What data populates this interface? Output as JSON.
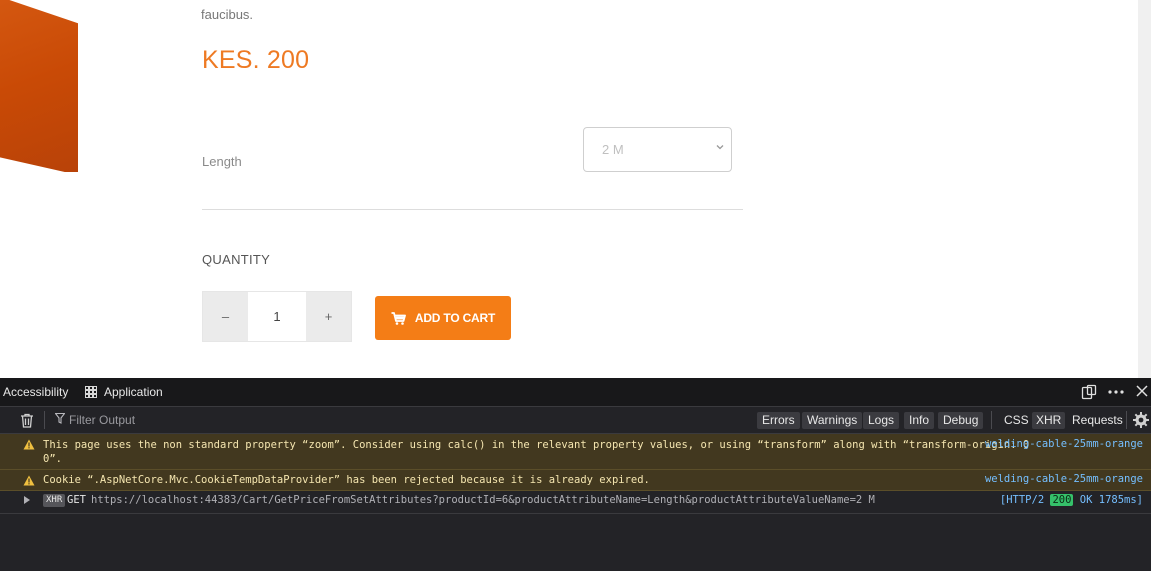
{
  "page": {
    "description_tail": "faucibus.",
    "price": "KES. 200",
    "attribute": {
      "label": "Length",
      "selected": "2 M"
    },
    "quantity": {
      "label": "QUANTITY",
      "decrement": "–",
      "value": "1",
      "increment": "+"
    },
    "add_to_cart_label": "ADD TO CART",
    "colors": {
      "accent": "#ee7a23",
      "button": "#f47d16"
    }
  },
  "devtools": {
    "tabs": {
      "accessibility": "Accessibility",
      "application": "Application"
    },
    "toolbar": {
      "filter_placeholder": "Filter Output",
      "levels": [
        "Errors",
        "Warnings",
        "Logs",
        "Info",
        "Debug"
      ],
      "css": "CSS",
      "xhr": "XHR",
      "requests": "Requests"
    },
    "messages": [
      {
        "type": "warning",
        "text_line1": "This page uses the non standard property “zoom”. Consider using calc() in the relevant property values, or using “transform” along with “transform-origin: 0",
        "text_line2": "0”.",
        "source": "welding-cable-25mm-orange"
      },
      {
        "type": "warning",
        "text": "Cookie “.AspNetCore.Mvc.CookieTempDataProvider” has been rejected because it is already expired.",
        "source": "welding-cable-25mm-orange"
      }
    ],
    "network": {
      "tag": "XHR",
      "method": "GET",
      "url": "https://localhost:44383/Cart/GetPriceFromSetAttributes?productId=6&productAttributeName=Length&productAttributeValueName=2 M",
      "protocol": "[HTTP/2",
      "status_code": "200",
      "status_text": "OK 1785ms]"
    }
  }
}
